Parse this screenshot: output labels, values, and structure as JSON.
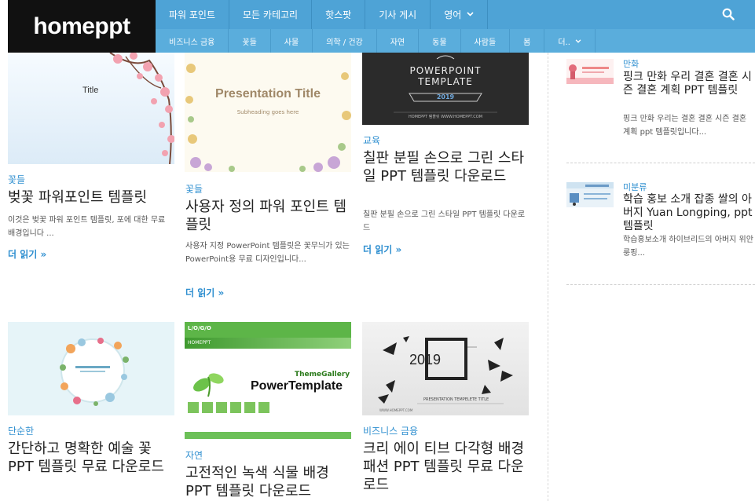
{
  "site": {
    "logo": "homeppt"
  },
  "topnav": [
    {
      "label": "파워 포인트"
    },
    {
      "label": "모든 카테고리"
    },
    {
      "label": "핫스팟"
    },
    {
      "label": "기사 게시"
    },
    {
      "label": "영어"
    }
  ],
  "subnav": [
    {
      "label": "비즈니스 금융"
    },
    {
      "label": "꽃들"
    },
    {
      "label": "사물"
    },
    {
      "label": "의학 / 건강"
    },
    {
      "label": "자연"
    },
    {
      "label": "동물"
    },
    {
      "label": "사람들"
    },
    {
      "label": "봄"
    },
    {
      "label": "더.."
    }
  ],
  "cards": [
    {
      "category": "꽃들",
      "title": "벚꽃 파워포인트 템플릿",
      "excerpt": "이것은 벚꽃 파워 포인트 템플릿, 포에 대한 무료 배경입니다 ...",
      "more": "더 읽기",
      "thumb_text": "Title"
    },
    {
      "category": "꽃들",
      "title": "사용자 정의 파워 포인트 템플릿",
      "excerpt": "사용자 지정 PowerPoint 템플릿은 꽃무늬가 있는 PowerPoint용 무료 디자인입니다...",
      "more": "더 읽기",
      "thumb_text": "Presentation Title",
      "thumb_sub": "Subheading goes here"
    },
    {
      "category": "교육",
      "title": "칠판 분필 손으로 그린 스타일 PPT 템플릿 다운로드",
      "excerpt": "칠판 분필 손으로 그린 스타일 PPT 템플릿 다운로드",
      "more": "더 읽기",
      "thumb_text_1": "POWERPOINT",
      "thumb_text_2": "TEMPLATE",
      "thumb_year": "2019",
      "thumb_url": "HOMEPPT 템플릿 WWW.HOMEPPT.COM"
    },
    {
      "category": "단순한",
      "title": "간단하고 명확한 예술 꽃 PPT 템플릿 무료 다운로드"
    },
    {
      "category": "자연",
      "title": "고전적인 녹색 식물 배경 PPT 템플릿 다운로드",
      "thumb_logo": "L/O/G/O",
      "thumb_brand": "HOMEPPT",
      "thumb_gallery": "ThemeGallery",
      "thumb_text": "PowerTemplate"
    },
    {
      "category": "비즈니스 금융",
      "title": "크리 에이 티브 다각형 배경 패션 PPT 템플릿 무료 다운로드",
      "thumb_year": "2019",
      "thumb_text": "PRESENTATION TEMPELETE TITLE",
      "thumb_url": "WWW.HOMEPPT.COM"
    }
  ],
  "sidebar": [
    {
      "category": "만화",
      "title": "핑크 만화 우리 결혼 결혼 시즌 결혼 계획 PPT 템플릿",
      "excerpt": "핑크 만화 우리는 결혼 결혼 시즌 결혼 계획 ppt 템플릿입니다..."
    },
    {
      "category": "미분류",
      "title": "학습 홍보 소개 잡종 쌀의 아버지 Yuan Longping, ppt 템플릿",
      "excerpt": "학습홍보소개 하이브리드의 아버지 위안룽핑..."
    }
  ],
  "colors": {
    "nav": "#4ea3d6",
    "subnav": "#5aaddc",
    "accent": "#2f8fd0",
    "logo_bg": "#111111"
  }
}
